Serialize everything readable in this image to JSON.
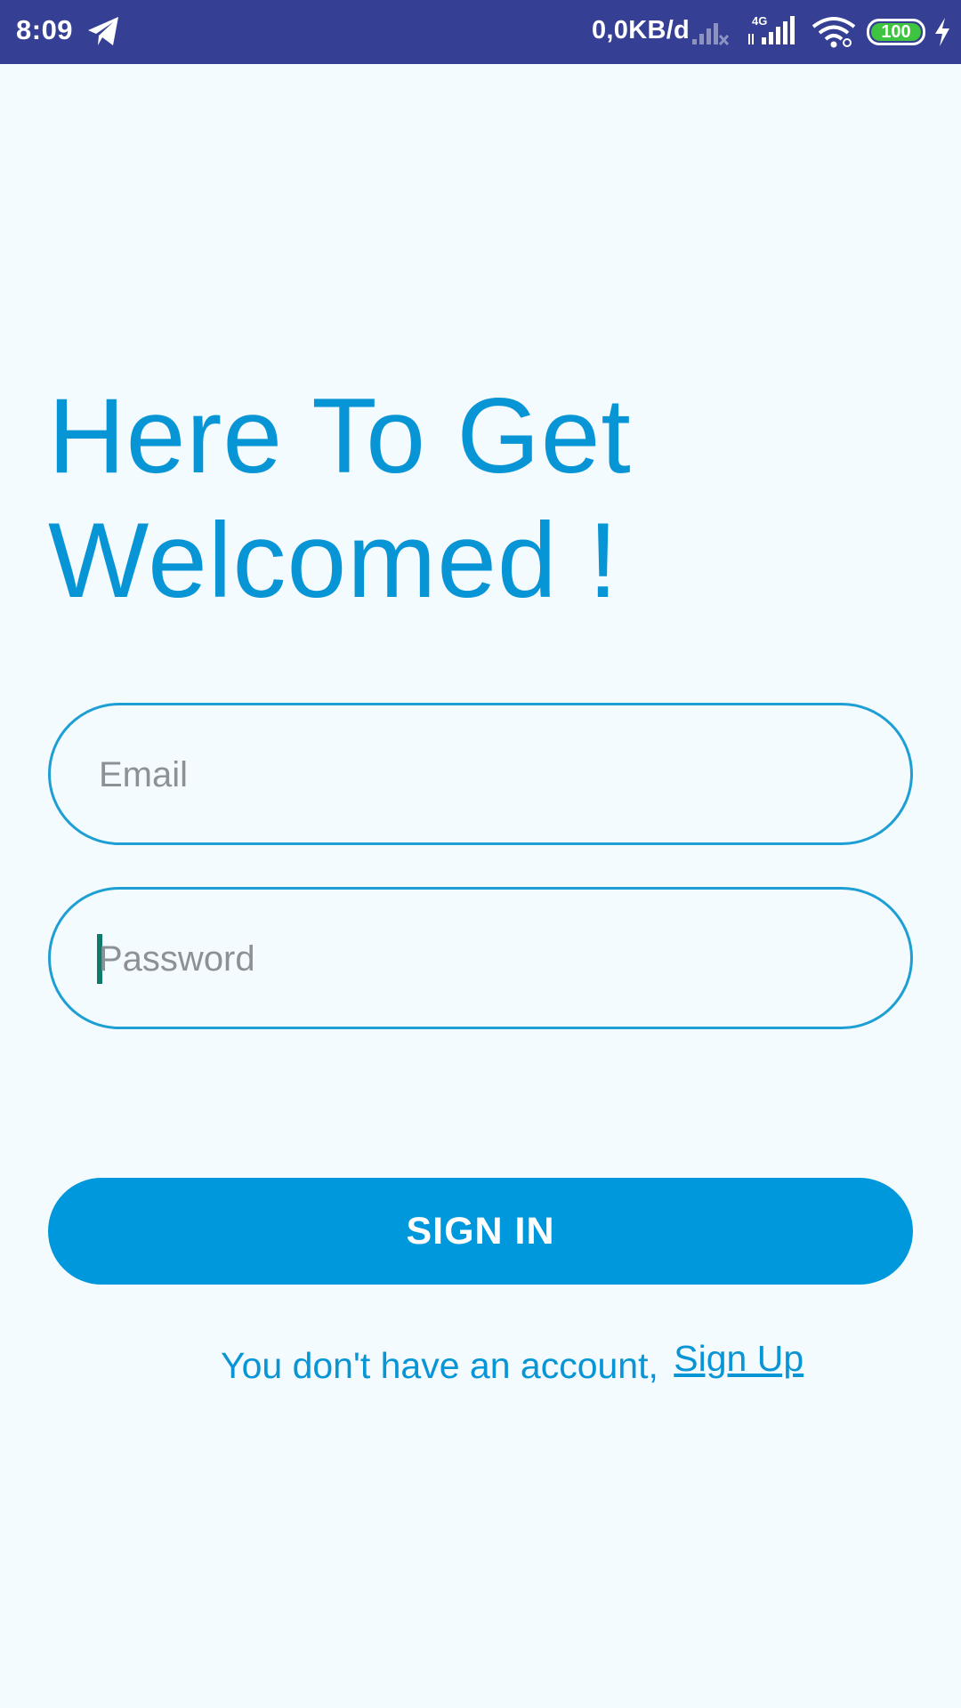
{
  "status_bar": {
    "time": "8:09",
    "net_speed": "0,0KB/d",
    "net_type": "4G",
    "battery_level": "100",
    "colors": {
      "background": "#353f93",
      "battery": "#3ec43e"
    },
    "icons": [
      "telegram-icon",
      "signal-icon",
      "wifi-icon",
      "battery-icon",
      "charging-icon"
    ]
  },
  "main": {
    "heading_line1": "Here To Get",
    "heading_line2": "Welcomed !",
    "email_placeholder": "Email",
    "password_placeholder": "Password",
    "sign_in_label": "SIGN IN",
    "signup_prompt": "You don't have an account,",
    "signup_link": "Sign Up"
  },
  "colors": {
    "accent": "#0098dc",
    "heading": "#0795d6",
    "background": "#f3fbff",
    "placeholder": "#8d9196",
    "caret": "#0e7b6a"
  }
}
